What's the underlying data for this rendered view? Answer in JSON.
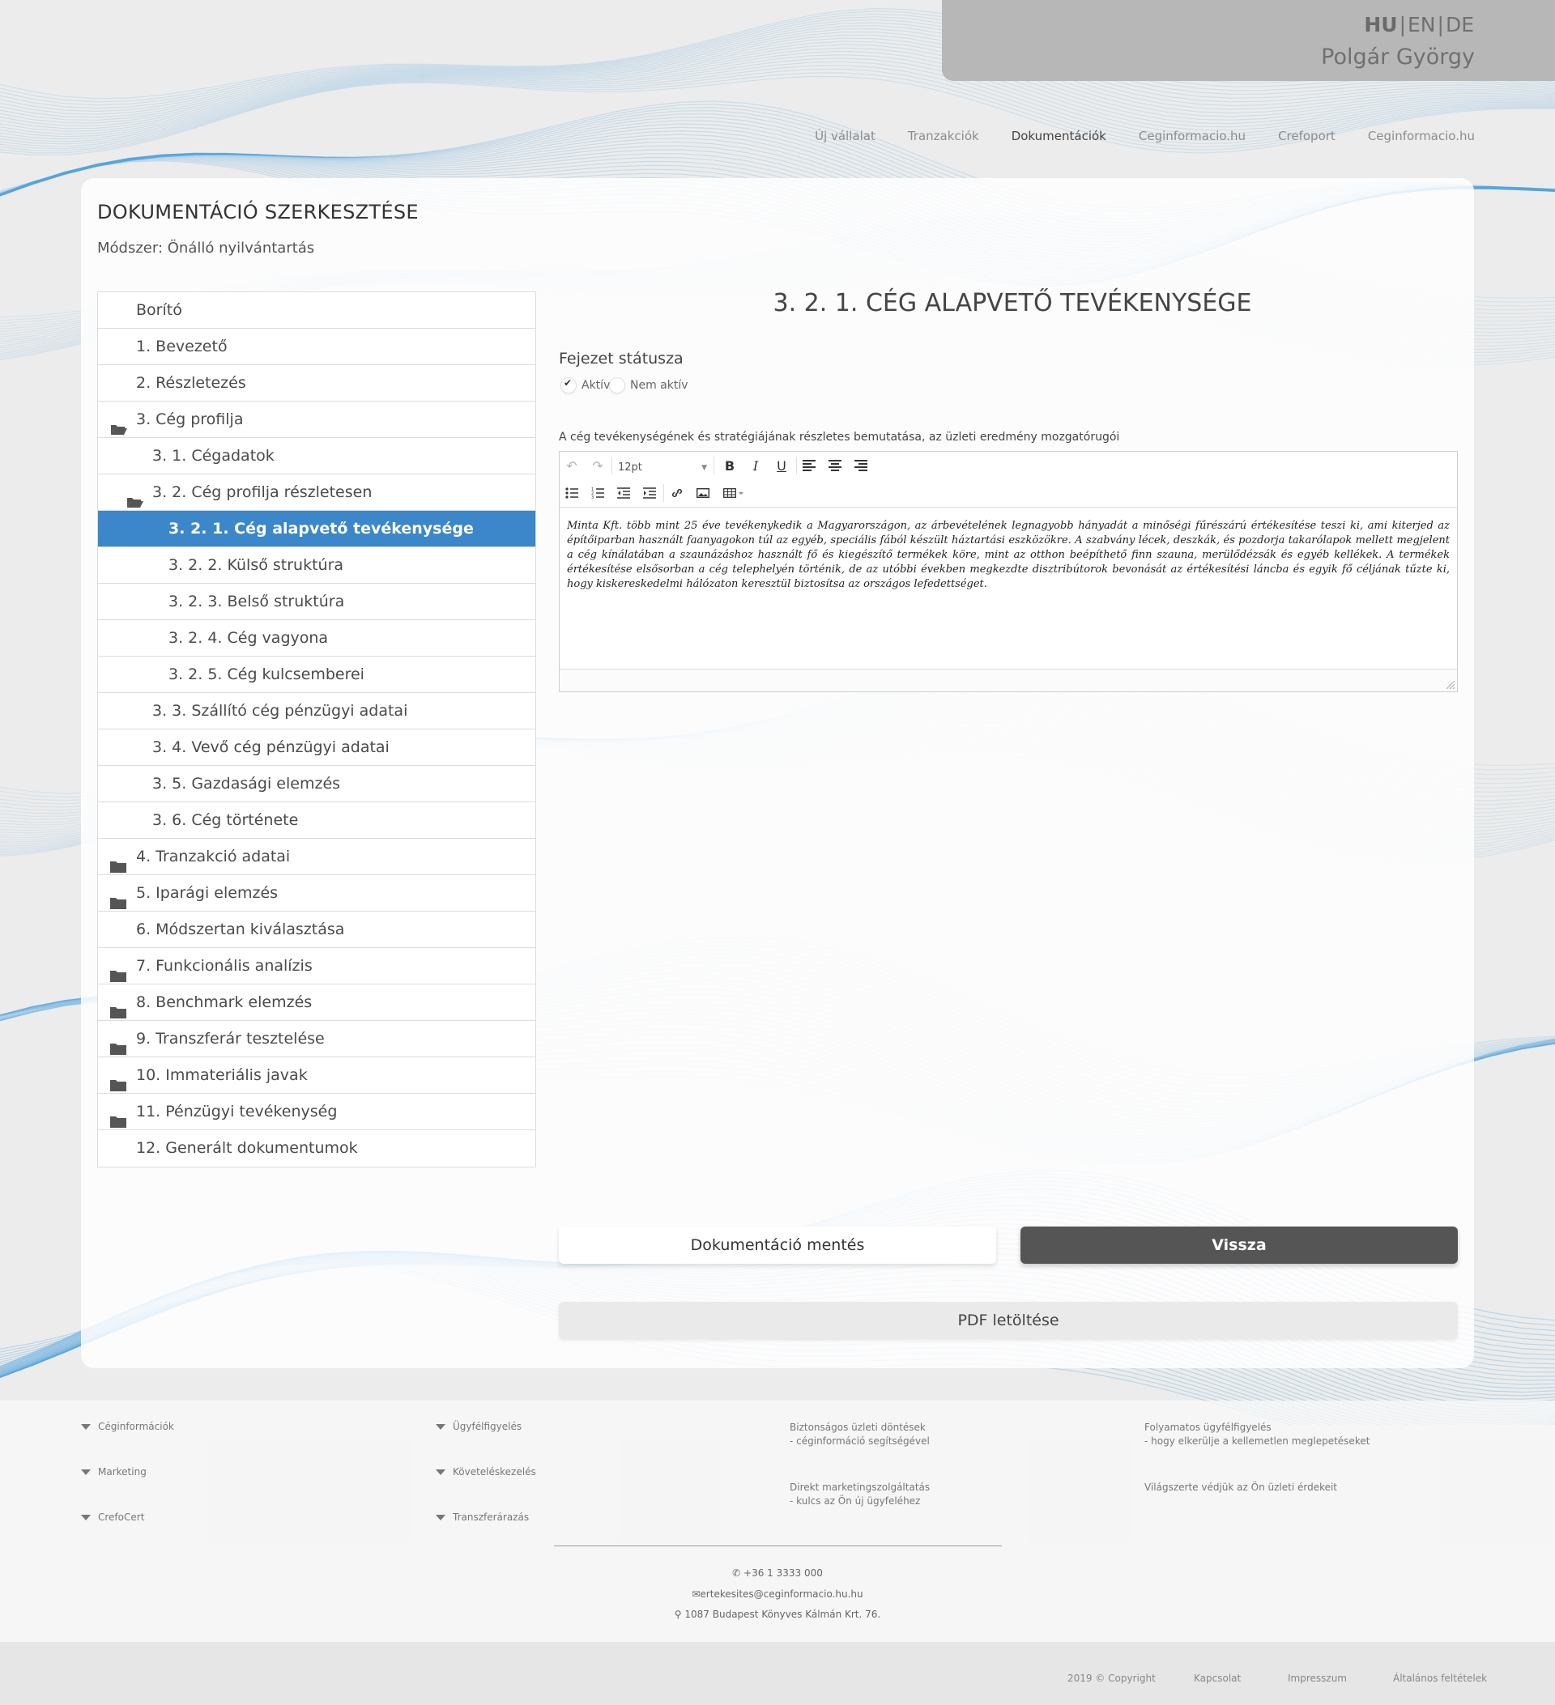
{
  "header": {
    "languages": [
      "HU",
      "EN",
      "DE"
    ],
    "active_language": "HU",
    "separator": "|",
    "user_name": "Polgár György"
  },
  "nav": [
    "Új vállalat",
    "Tranzakciók",
    "Dokumentációk",
    "Ceginformacio.hu",
    "Crefoport",
    "Ceginformacio.hu"
  ],
  "nav_active": "Dokumentációk",
  "page": {
    "title": "DOKUMENTÁCIÓ SZERKESZTÉSE",
    "method": "Módszer: Önálló nyilvántartás"
  },
  "tree": [
    {
      "label": "Borító",
      "level": 0,
      "icon": ""
    },
    {
      "label": "1. Bevezető",
      "level": 0,
      "icon": ""
    },
    {
      "label": "2. Részletezés",
      "level": 0,
      "icon": ""
    },
    {
      "label": "3. Cég profilja",
      "level": 0,
      "icon": "folder-open-icon"
    },
    {
      "label": "3. 1. Cégadatok",
      "level": 1,
      "icon": ""
    },
    {
      "label": "3. 2. Cég profilja részletesen",
      "level": 1,
      "icon": "folder-open-icon"
    },
    {
      "label": "3. 2. 1. Cég alapvető tevékenysége",
      "level": 2,
      "icon": "",
      "selected": true
    },
    {
      "label": "3. 2. 2. Külső struktúra",
      "level": 2,
      "icon": ""
    },
    {
      "label": "3. 2. 3. Belső struktúra",
      "level": 2,
      "icon": ""
    },
    {
      "label": "3. 2. 4. Cég vagyona",
      "level": 2,
      "icon": ""
    },
    {
      "label": "3. 2. 5. Cég kulcsemberei",
      "level": 2,
      "icon": ""
    },
    {
      "label": "3. 3. Szállító cég pénzügyi adatai",
      "level": 1,
      "icon": ""
    },
    {
      "label": "3. 4. Vevő cég pénzügyi adatai",
      "level": 1,
      "icon": ""
    },
    {
      "label": "3. 5. Gazdasági elemzés",
      "level": 1,
      "icon": ""
    },
    {
      "label": "3. 6. Cég története",
      "level": 1,
      "icon": ""
    },
    {
      "label": "4. Tranzakció adatai",
      "level": 0,
      "icon": "folder-icon"
    },
    {
      "label": "5. Iparági elemzés",
      "level": 0,
      "icon": "folder-icon"
    },
    {
      "label": "6. Módszertan kiválasztása",
      "level": 0,
      "icon": ""
    },
    {
      "label": "7. Funkcionális analízis",
      "level": 0,
      "icon": "folder-icon"
    },
    {
      "label": "8. Benchmark elemzés",
      "level": 0,
      "icon": "folder-icon"
    },
    {
      "label": "9. Transzferár tesztelése",
      "level": 0,
      "icon": "folder-icon"
    },
    {
      "label": "10. Immateriális javak",
      "level": 0,
      "icon": "folder-icon"
    },
    {
      "label": "11. Pénzügyi tevékenység",
      "level": 0,
      "icon": "folder-icon"
    },
    {
      "label": "12. Generált dokumentumok",
      "level": 0,
      "icon": ""
    }
  ],
  "section": {
    "title": "3. 2. 1. CÉG ALAPVETŐ TEVÉKENYSÉGE",
    "status_label": "Fejezet státusza",
    "status_options": [
      "Aktív",
      "Nem aktív"
    ],
    "status_selected": "Aktív",
    "description_label": "A cég tevékenységének és stratégiájának részletes bemutatása, az üzleti eredmény mozgatórugói",
    "font_size": "12pt",
    "content": "Minta Kft. több mint 25 éve tevékenykedik a Magyarországon, az árbevételének legnagyobb hányadát a minőségi fűrészárú értékesítése teszi ki, ami kiterjed az építőiparban használt faanyagokon túl az egyéb, speciális fából készült háztartási eszközökre. A szabvány lécek, deszkák, és pozdorja takarólapok mellett megjelent a cég kínálatában a szaunázáshoz használt fő és kiegészítő termékek köre, mint az otthon beépíthető finn szauna, merülődézsák és egyéb kellékek. A termékek értékesítése elsősorban a cég telephelyén történik, de az utóbbi években megkezdte disztribútorok bevonását az értékesítési láncba és egyik fő céljának tűzte ki, hogy kiskereskedelmi hálózaton keresztül biztosítsa az országos lefedettséget."
  },
  "buttons": {
    "save": "Dokumentáció mentés",
    "back": "Vissza",
    "pdf": "PDF letöltése"
  },
  "footer": {
    "col1": [
      "Céginformációk",
      "Marketing",
      "CrefoCert"
    ],
    "col2": [
      "Ügyfélfigyelés",
      "Követeléskezelés",
      "Transzferárazás"
    ],
    "col3": [
      {
        "title": "Biztonságos üzleti döntések",
        "sub": "- céginformáció segítségével"
      },
      {
        "title": "Direkt marketingszolgáltatás",
        "sub": "- kulcs az Ön új ügyfeléhez"
      }
    ],
    "col4": [
      {
        "title": "Folyamatos ügyfélfigyelés",
        "sub": "- hogy elkerülje a kellemetlen meglepetéseket"
      },
      {
        "title": "Világszerte védjük az Ön üzleti érdekeit",
        "sub": ""
      }
    ],
    "phone": "+36 1 3333 000",
    "email": "ertekesites@ceginformacio.hu.hu",
    "address": "1087 Budapest Könyves Kálmán Krt. 76."
  },
  "bottom": {
    "copyright": "2019 © Copyright",
    "links": [
      "Kapcsolat",
      "Impresszum",
      "Általános feltételek"
    ]
  },
  "colors": {
    "accent": "#3b87c9",
    "back_button": "#555555",
    "wave": "#4a9edd"
  }
}
